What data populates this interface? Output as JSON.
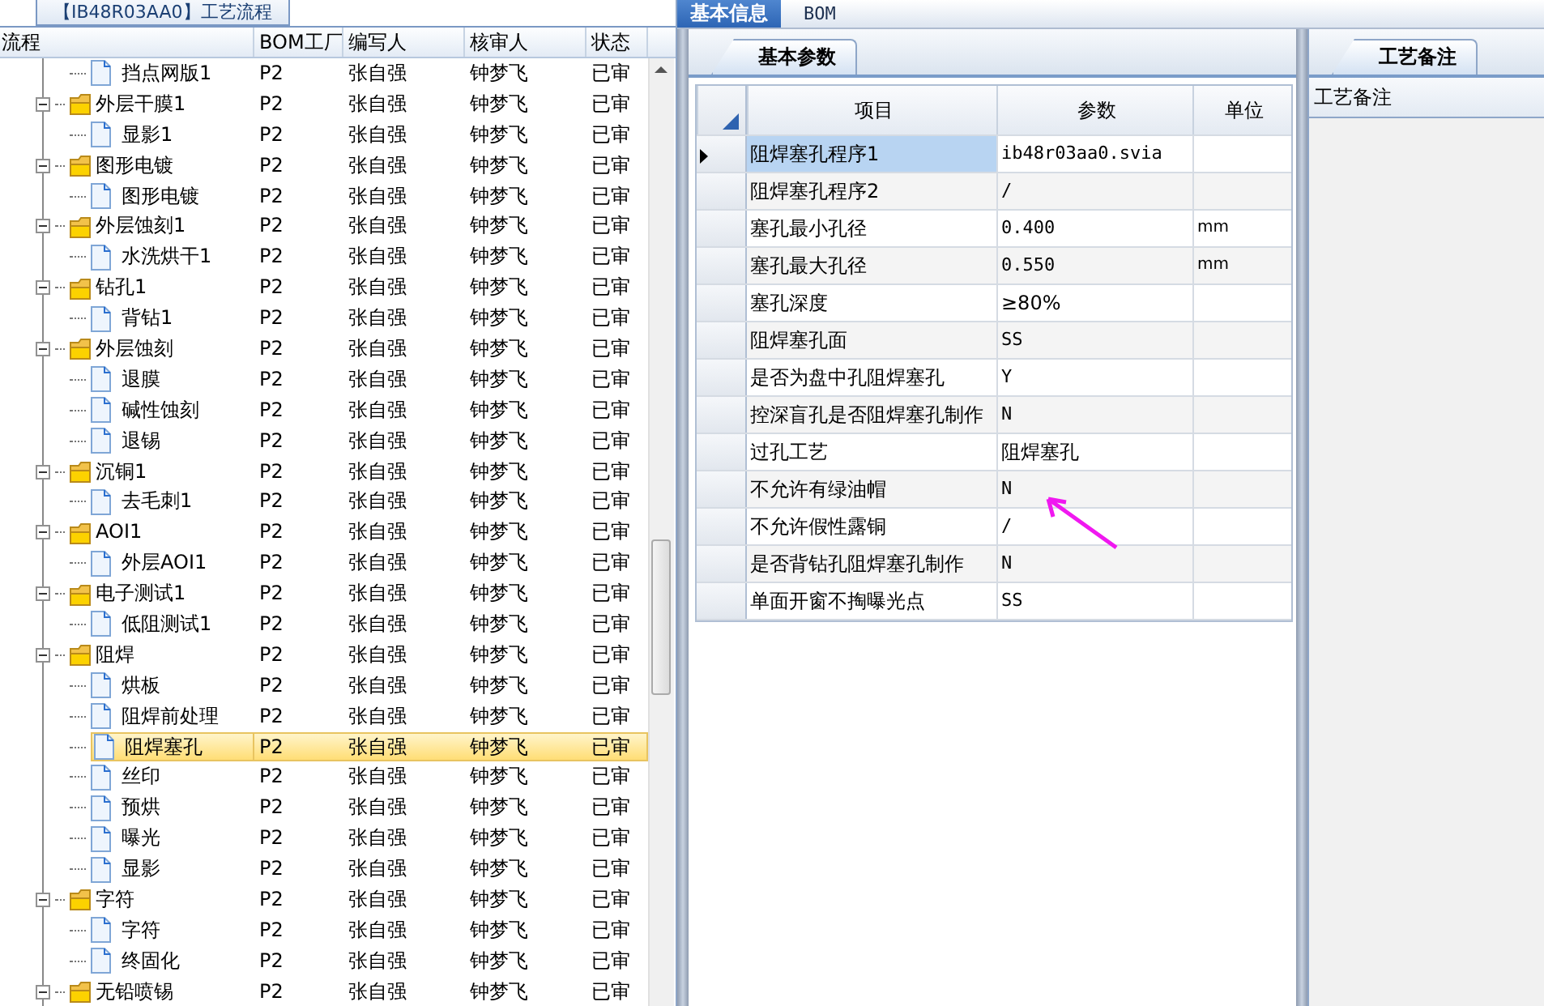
{
  "tree": {
    "title": "【IB48R03AA0】工艺流程",
    "columns": [
      "流程",
      "BOM工厂",
      "编写人",
      "核审人",
      "状态"
    ],
    "nodes": [
      {
        "kind": "leaf",
        "label": "挡点网版1",
        "selected": false,
        "cells": [
          "P2",
          "张自强",
          "钟梦飞",
          "已审"
        ]
      },
      {
        "kind": "folder",
        "label": "外层干膜1",
        "expanded": true,
        "selected": false,
        "cells": [
          "P2",
          "张自强",
          "钟梦飞",
          "已审"
        ],
        "children": [
          {
            "kind": "leaf",
            "label": "显影1",
            "selected": false,
            "cells": [
              "P2",
              "张自强",
              "钟梦飞",
              "已审"
            ]
          }
        ]
      },
      {
        "kind": "folder",
        "label": "图形电镀",
        "expanded": true,
        "selected": false,
        "cells": [
          "P2",
          "张自强",
          "钟梦飞",
          "已审"
        ],
        "children": [
          {
            "kind": "leaf",
            "label": "图形电镀",
            "selected": false,
            "cells": [
              "P2",
              "张自强",
              "钟梦飞",
              "已审"
            ]
          }
        ]
      },
      {
        "kind": "folder",
        "label": "外层蚀刻1",
        "expanded": true,
        "selected": false,
        "cells": [
          "P2",
          "张自强",
          "钟梦飞",
          "已审"
        ],
        "children": [
          {
            "kind": "leaf",
            "label": "水洗烘干1",
            "selected": false,
            "cells": [
              "P2",
              "张自强",
              "钟梦飞",
              "已审"
            ]
          }
        ]
      },
      {
        "kind": "folder",
        "label": "钻孔1",
        "expanded": true,
        "selected": false,
        "cells": [
          "P2",
          "张自强",
          "钟梦飞",
          "已审"
        ],
        "children": [
          {
            "kind": "leaf",
            "label": "背钻1",
            "selected": false,
            "cells": [
              "P2",
              "张自强",
              "钟梦飞",
              "已审"
            ]
          }
        ]
      },
      {
        "kind": "folder",
        "label": "外层蚀刻",
        "expanded": true,
        "selected": false,
        "cells": [
          "P2",
          "张自强",
          "钟梦飞",
          "已审"
        ],
        "children": [
          {
            "kind": "leaf",
            "label": "退膜",
            "selected": false,
            "cells": [
              "P2",
              "张自强",
              "钟梦飞",
              "已审"
            ]
          },
          {
            "kind": "leaf",
            "label": "碱性蚀刻",
            "selected": false,
            "cells": [
              "P2",
              "张自强",
              "钟梦飞",
              "已审"
            ]
          },
          {
            "kind": "leaf",
            "label": "退锡",
            "selected": false,
            "cells": [
              "P2",
              "张自强",
              "钟梦飞",
              "已审"
            ]
          }
        ]
      },
      {
        "kind": "folder",
        "label": "沉铜1",
        "expanded": true,
        "selected": false,
        "cells": [
          "P2",
          "张自强",
          "钟梦飞",
          "已审"
        ],
        "children": [
          {
            "kind": "leaf",
            "label": "去毛刺1",
            "selected": false,
            "cells": [
              "P2",
              "张自强",
              "钟梦飞",
              "已审"
            ]
          }
        ]
      },
      {
        "kind": "folder",
        "label": "AOI1",
        "expanded": true,
        "selected": false,
        "cells": [
          "P2",
          "张自强",
          "钟梦飞",
          "已审"
        ],
        "children": [
          {
            "kind": "leaf",
            "label": "外层AOI1",
            "selected": false,
            "cells": [
              "P2",
              "张自强",
              "钟梦飞",
              "已审"
            ]
          }
        ]
      },
      {
        "kind": "folder",
        "label": "电子测试1",
        "expanded": true,
        "selected": false,
        "cells": [
          "P2",
          "张自强",
          "钟梦飞",
          "已审"
        ],
        "children": [
          {
            "kind": "leaf",
            "label": "低阻测试1",
            "selected": false,
            "cells": [
              "P2",
              "张自强",
              "钟梦飞",
              "已审"
            ]
          }
        ]
      },
      {
        "kind": "folder",
        "label": "阻焊",
        "expanded": true,
        "selected": false,
        "cells": [
          "P2",
          "张自强",
          "钟梦飞",
          "已审"
        ],
        "children": [
          {
            "kind": "leaf",
            "label": "烘板",
            "selected": false,
            "cells": [
              "P2",
              "张自强",
              "钟梦飞",
              "已审"
            ]
          },
          {
            "kind": "leaf",
            "label": "阻焊前处理",
            "selected": false,
            "cells": [
              "P2",
              "张自强",
              "钟梦飞",
              "已审"
            ]
          },
          {
            "kind": "leaf",
            "label": "阻焊塞孔",
            "selected": true,
            "cells": [
              "P2",
              "张自强",
              "钟梦飞",
              "已审"
            ]
          },
          {
            "kind": "leaf",
            "label": "丝印",
            "selected": false,
            "cells": [
              "P2",
              "张自强",
              "钟梦飞",
              "已审"
            ]
          },
          {
            "kind": "leaf",
            "label": "预烘",
            "selected": false,
            "cells": [
              "P2",
              "张自强",
              "钟梦飞",
              "已审"
            ]
          },
          {
            "kind": "leaf",
            "label": "曝光",
            "selected": false,
            "cells": [
              "P2",
              "张自强",
              "钟梦飞",
              "已审"
            ]
          },
          {
            "kind": "leaf",
            "label": "显影",
            "selected": false,
            "cells": [
              "P2",
              "张自强",
              "钟梦飞",
              "已审"
            ]
          }
        ]
      },
      {
        "kind": "folder",
        "label": "字符",
        "expanded": true,
        "selected": false,
        "cells": [
          "P2",
          "张自强",
          "钟梦飞",
          "已审"
        ],
        "children": [
          {
            "kind": "leaf",
            "label": "字符",
            "selected": false,
            "cells": [
              "P2",
              "张自强",
              "钟梦飞",
              "已审"
            ]
          },
          {
            "kind": "leaf",
            "label": "终固化",
            "selected": false,
            "cells": [
              "P2",
              "张自强",
              "钟梦飞",
              "已审"
            ]
          }
        ]
      },
      {
        "kind": "folder",
        "label": "无铅喷锡",
        "expanded": true,
        "selected": false,
        "cells": [
          "P2",
          "张自强",
          "钟梦飞",
          "已审"
        ]
      }
    ]
  },
  "tabs": [
    {
      "label": "基本信息",
      "selected": true
    },
    {
      "label": "BOM",
      "selected": false
    }
  ],
  "params": {
    "tab": "基本参数",
    "columns": [
      "项目",
      "参数",
      "单位"
    ],
    "rows": [
      {
        "item": "阻焊塞孔程序1",
        "value": "ib48r03aa0.svia",
        "selected": true
      },
      {
        "item": "阻焊塞孔程序2",
        "value": "/",
        "selected": false
      },
      {
        "item": "塞孔最小孔径",
        "value": "0.400",
        "unit": "mm",
        "selected": false
      },
      {
        "item": "塞孔最大孔径",
        "value": "0.550",
        "unit": "mm",
        "selected": false
      },
      {
        "item": "塞孔深度",
        "value": "≥80%",
        "selected": false
      },
      {
        "item": "阻焊塞孔面",
        "value": "SS",
        "selected": false
      },
      {
        "item": "是否为盘中孔阻焊塞孔",
        "value": "Y",
        "selected": false
      },
      {
        "item": "控深盲孔是否阻焊塞孔制作",
        "value": "N",
        "selected": false
      },
      {
        "item": "过孔工艺",
        "value": "阻焊塞孔",
        "selected": false
      },
      {
        "item": "不允许有绿油帽",
        "value": "N",
        "selected": false
      },
      {
        "item": "不允许假性露铜",
        "value": "/",
        "selected": false
      },
      {
        "item": "是否背钻孔阻焊塞孔制作",
        "value": "N",
        "selected": false
      },
      {
        "item": "单面开窗不掏曝光点",
        "value": "SS",
        "selected": false
      }
    ]
  },
  "notes": {
    "tab": "工艺备注",
    "label": "工艺备注"
  }
}
